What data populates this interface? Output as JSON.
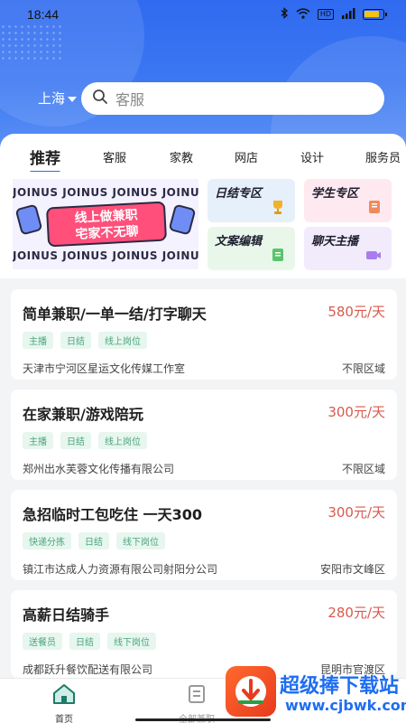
{
  "status_bar": {
    "time": "18:44",
    "network_badge": "HD",
    "battery_level": 0.85
  },
  "location": {
    "city": "上海"
  },
  "search": {
    "placeholder": "客服"
  },
  "tabs": [
    {
      "label": "推荐",
      "active": true
    },
    {
      "label": "客服"
    },
    {
      "label": "家教"
    },
    {
      "label": "网店"
    },
    {
      "label": "设计"
    },
    {
      "label": "服务员"
    }
  ],
  "banner": {
    "repeat_text": "JOINUS JOINUS JOINUS JOINUS",
    "line1": "线上做兼职",
    "line2": "宅家不无聊"
  },
  "zones": [
    {
      "label": "日结专区",
      "color": "#e6f0fb",
      "icon": "trophy-icon"
    },
    {
      "label": "学生专区",
      "color": "#fde9ef",
      "icon": "notebook-icon"
    },
    {
      "label": "文案编辑",
      "color": "#e8f7ea",
      "icon": "document-icon"
    },
    {
      "label": "聊天主播",
      "color": "#f1ebfc",
      "icon": "camera-icon"
    }
  ],
  "jobs": [
    {
      "title": "简单兼职/一单一结/打字聊天",
      "salary": "580元/天",
      "tags": [
        "主播",
        "日结",
        "线上岗位"
      ],
      "company": "天津市宁河区星运文化传媒工作室",
      "area": "不限区域"
    },
    {
      "title": "在家兼职/游戏陪玩",
      "salary": "300元/天",
      "tags": [
        "主播",
        "日结",
        "线上岗位"
      ],
      "company": "郑州出水芙蓉文化传播有限公司",
      "area": "不限区域"
    },
    {
      "title": "急招临时工包吃住 一天300",
      "salary": "300元/天",
      "tags": [
        "快递分拣",
        "日结",
        "线下岗位"
      ],
      "company": "镇江市达成人力资源有限公司射阳分公司",
      "area": "安阳市文峰区"
    },
    {
      "title": "高薪日结骑手",
      "salary": "280元/天",
      "tags": [
        "送餐员",
        "日结",
        "线下岗位"
      ],
      "company": "成都跃升餐饮配送有限公司",
      "area": "昆明市官渡区"
    }
  ],
  "bottom_nav": [
    {
      "label": "首页",
      "icon": "home-icon",
      "active": true
    },
    {
      "label": "全部兼职",
      "icon": "list-icon"
    }
  ],
  "watermark": {
    "text": "超级捧下载站",
    "url": "www.cjbwk.com"
  },
  "colors": {
    "primary": "#2f6af0",
    "salary": "#d85a4f",
    "tag_text": "#4aa57d",
    "tag_bg": "#e7f6ef"
  }
}
